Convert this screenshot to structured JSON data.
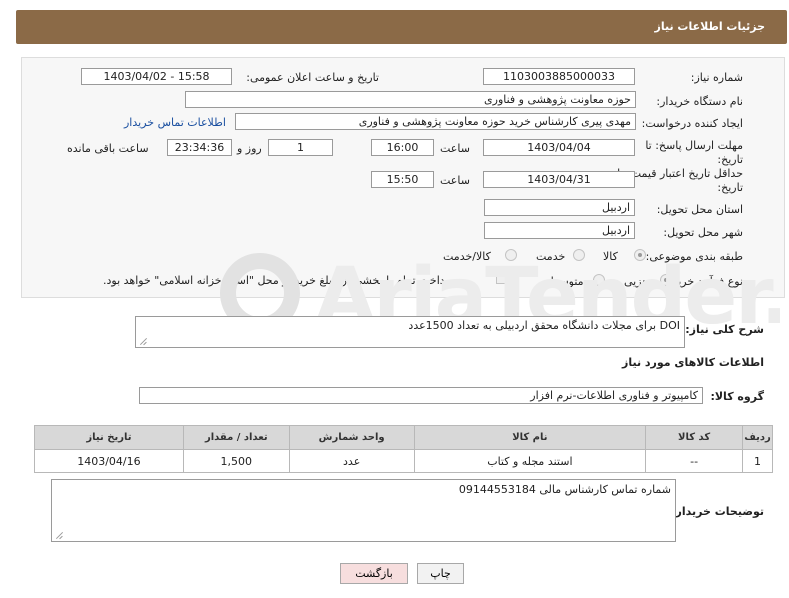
{
  "header": {
    "title": "جزئیات اطلاعات نیاز"
  },
  "form": {
    "need_number_label": "شماره نیاز:",
    "need_number": "1103003885000033",
    "announce_label": "تاریخ و ساعت اعلان عمومی:",
    "announce_value": "1403/04/02 - 15:58",
    "buyer_org_label": "نام دستگاه خریدار:",
    "buyer_org": "حوزه معاونت پژوهشی و فناوری",
    "creator_label": "ایجاد کننده درخواست:",
    "creator": "مهدی پیری کارشناس خرید حوزه معاونت پژوهشی و فناوری",
    "contact_link": "اطلاعات تماس خریدار",
    "reply_deadline_label_1": "مهلت ارسال پاسخ: تا",
    "reply_deadline_label_2": "تاریخ:",
    "reply_date": "1403/04/04",
    "time_label": "ساعت",
    "reply_time": "16:00",
    "days": "1",
    "days_label": "روز و",
    "remaining": "23:34:36",
    "remaining_label": "ساعت باقی مانده",
    "price_validity_label_1": "حداقل تاریخ اعتبار قیمت: تا",
    "price_validity_label_2": "تاریخ:",
    "price_date": "1403/04/31",
    "price_time": "15:50",
    "province_label": "استان محل تحویل:",
    "province": "اردبیل",
    "city_label": "شهر محل تحویل:",
    "city": "اردبیل",
    "category_label": "طبقه بندی موضوعی:",
    "category_options": [
      "کالا",
      "خدمت",
      "کالا/خدمت"
    ],
    "process_label": "نوع فرآیند خرید :",
    "process_options": [
      "جزیی",
      "متوسط"
    ],
    "payment_note": "پرداخت تمام یا بخشی از مبلغ خرید،از محل \"اسناد خزانه اسلامی\" خواهد بود."
  },
  "summary": {
    "label": "شرح کلی نیاز:",
    "value": "DOI برای مجلات دانشگاه محقق اردبیلی به تعداد 1500عدد"
  },
  "goods": {
    "section_title": "اطلاعات کالاهای مورد نیاز",
    "group_label": "گروه کالا:",
    "group_value": "کامپیوتر و فناوری اطلاعات-نرم افزار",
    "columns": [
      "ردیف",
      "کد کالا",
      "نام کالا",
      "واحد شمارش",
      "تعداد / مقدار",
      "تاریخ نیاز"
    ],
    "rows": [
      [
        "1",
        "--",
        "استند مجله و کتاب",
        "عدد",
        "1,500",
        "1403/04/16"
      ]
    ]
  },
  "buyer_notes": {
    "label": "توضیحات خریدار:",
    "value": "شماره تماس کارشناس مالی 09144553184"
  },
  "buttons": {
    "print": "چاپ",
    "back": "بازگشت"
  },
  "watermark": {
    "text": "AriaTender.net"
  },
  "colors": {
    "header": "#8b6a47",
    "link": "#1a4fa0",
    "back_button": "#f7dede"
  }
}
